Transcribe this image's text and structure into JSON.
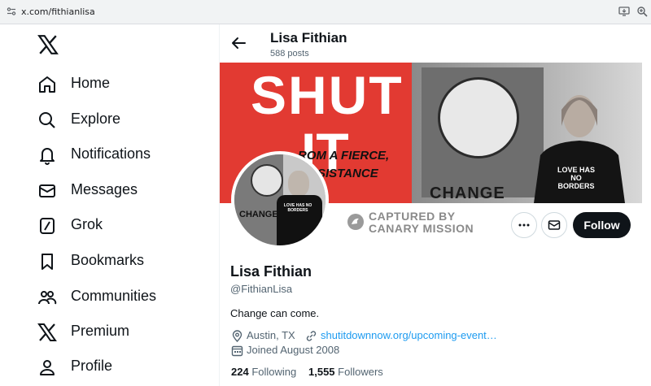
{
  "browser": {
    "url": "x.com/fithianlisa"
  },
  "nav": {
    "items": [
      {
        "label": "Home",
        "icon": "home-icon"
      },
      {
        "label": "Explore",
        "icon": "search-icon"
      },
      {
        "label": "Notifications",
        "icon": "bell-icon"
      },
      {
        "label": "Messages",
        "icon": "envelope-icon"
      },
      {
        "label": "Grok",
        "icon": "grok-icon"
      },
      {
        "label": "Bookmarks",
        "icon": "bookmark-icon"
      },
      {
        "label": "Communities",
        "icon": "communities-icon"
      },
      {
        "label": "Premium",
        "icon": "x-logo-icon"
      },
      {
        "label": "Profile",
        "icon": "person-icon"
      }
    ]
  },
  "header": {
    "name": "Lisa Fithian",
    "posts": "588 posts"
  },
  "banner": {
    "big_text_1": "SHUT",
    "big_text_2": "IT",
    "hand_1": "ROM A FIERCE,",
    "hand_2": "SISTANCE",
    "poster_text": "CHANGE",
    "shirt_text": "LOVE HAS NO BORDERS"
  },
  "avatar": {
    "poster_text": "CHANGE",
    "shirt_text": "LOVE HAS NO BORDERS"
  },
  "watermark": {
    "line1": "CAPTURED BY",
    "line2": "CANARY MISSION"
  },
  "actions": {
    "follow_label": "Follow"
  },
  "profile": {
    "name": "Lisa Fithian",
    "handle": "@FithianLisa",
    "bio": "Change can come.",
    "location": "Austin, TX",
    "website": "shutitdownnow.org/upcoming-event…",
    "joined": "Joined August 2008",
    "following_count": "224",
    "following_label": "Following",
    "followers_count": "1,555",
    "followers_label": "Followers"
  },
  "colors": {
    "accent_link": "#1d9bf0",
    "text_primary": "#0f1419",
    "text_secondary": "#536471",
    "banner_red": "#e23a32"
  }
}
